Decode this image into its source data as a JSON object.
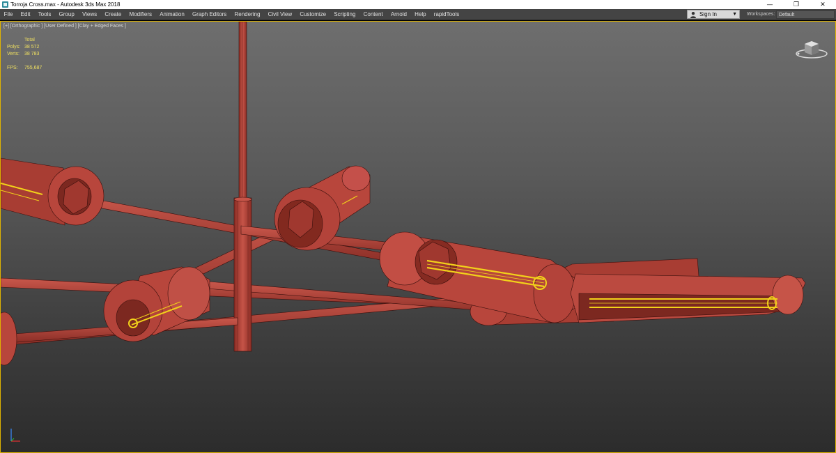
{
  "window": {
    "title": "Torroja Cross.max - Autodesk 3ds Max 2018",
    "controls": {
      "minimize": "—",
      "maximize": "❐",
      "close": "✕"
    }
  },
  "menu": {
    "items": [
      "File",
      "Edit",
      "Tools",
      "Group",
      "Views",
      "Create",
      "Modifiers",
      "Animation",
      "Graph Editors",
      "Rendering",
      "Civil View",
      "Customize",
      "Scripting",
      "Content",
      "Arnold",
      "Help",
      "rapidTools"
    ],
    "sign_in": "Sign In",
    "workspaces_label": "Workspaces:",
    "workspace_value": "Default"
  },
  "viewport": {
    "label": "[+] [Orthographic ] [User Defined ] [Clay + Edged Faces ]",
    "stats": {
      "header": "Total",
      "polys_label": "Polys:",
      "polys_value": "38 572",
      "verts_label": "Verts:",
      "verts_value": "38 783",
      "fps_label": "FPS:",
      "fps_value": "755,687"
    }
  },
  "colors": {
    "clay": "#b8463c",
    "clay_dark": "#7a2620",
    "selection": "#f2d21a",
    "viewport_border": "#e0b400"
  },
  "icons": {
    "app": "3ds-max-icon",
    "user": "user-icon",
    "viewcube": "viewcube-icon",
    "axis": "axis-tripod-icon"
  }
}
